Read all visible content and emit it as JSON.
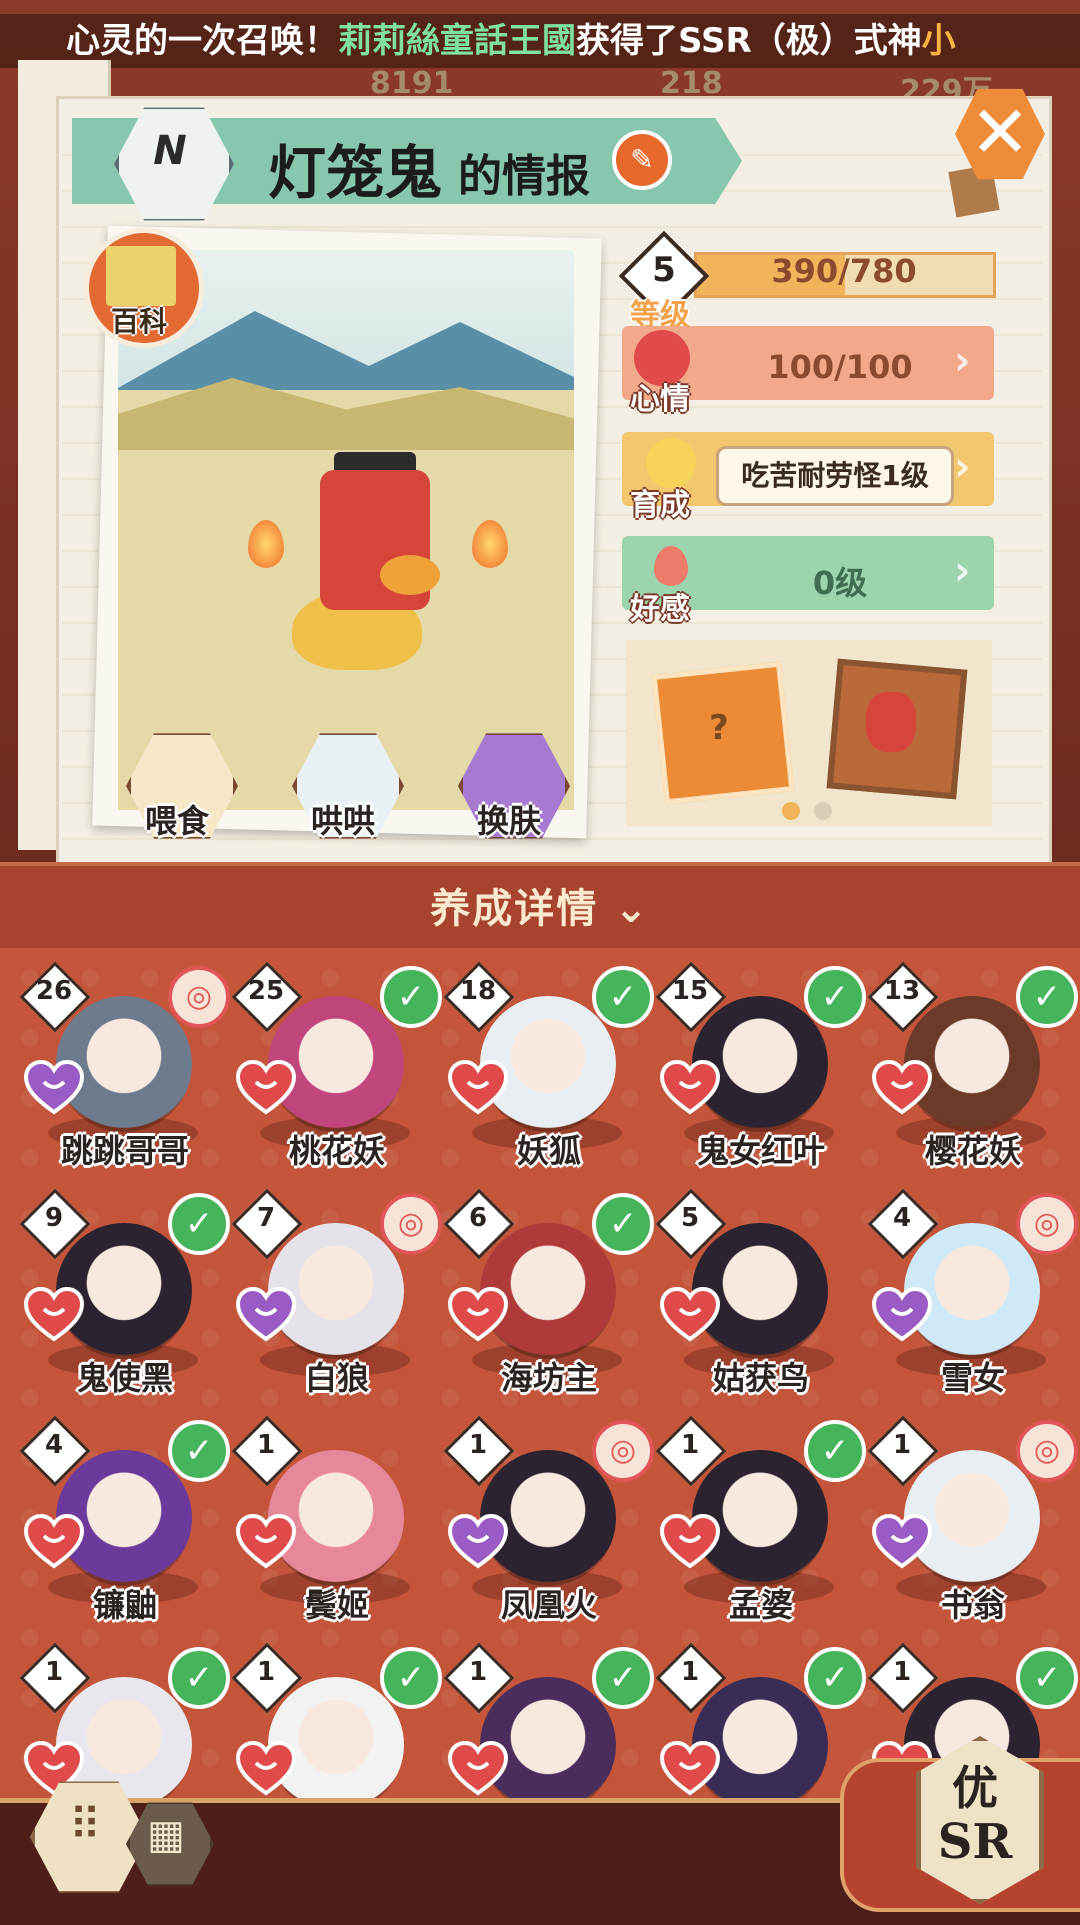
{
  "ticker": {
    "part1": "心灵的一次召唤！",
    "player": "莉莉絲童話王國",
    "part2": "获得了SSR（极）式神",
    "shikigami": "小"
  },
  "currencies": [
    "8191",
    "218",
    "229万"
  ],
  "header": {
    "rarity": "N",
    "name": "灯笼鬼",
    "suffix": "的情报"
  },
  "wiki": {
    "label": "百科"
  },
  "actions": [
    {
      "label": "喂食",
      "icon": "noodle-bowl-icon"
    },
    {
      "label": "哄哄",
      "icon": "milk-carton-icon"
    },
    {
      "label": "换肤",
      "icon": "skin-kimono-icon"
    }
  ],
  "stats": {
    "level": {
      "value": "5",
      "label": "等级",
      "xp": "390/780",
      "xp_fraction": 0.5
    },
    "mood": {
      "label": "心情",
      "value": "100/100"
    },
    "growth": {
      "label": "育成",
      "value": "吃苦耐劳怪1级"
    },
    "affinity": {
      "label": "好感",
      "value": "0级"
    }
  },
  "pictures": {
    "page_count": 2,
    "current_page": 1
  },
  "detail": {
    "label": "养成详情"
  },
  "shikigami_list": [
    {
      "level": "26",
      "name": "跳跳哥哥",
      "status": "ring",
      "heart": "purple",
      "hair": "#6d7b8c"
    },
    {
      "level": "25",
      "name": "桃花妖",
      "status": "check",
      "heart": "red",
      "hair": "#c0457a"
    },
    {
      "level": "18",
      "name": "妖狐",
      "status": "check",
      "heart": "red",
      "hair": "#e9eef2"
    },
    {
      "level": "15",
      "name": "鬼女红叶",
      "status": "check",
      "heart": "red",
      "hair": "#2b2430"
    },
    {
      "level": "13",
      "name": "樱花妖",
      "status": "check",
      "heart": "red",
      "hair": "#6b3a28"
    },
    {
      "level": "9",
      "name": "鬼使黑",
      "status": "check",
      "heart": "red",
      "hair": "#2b2430"
    },
    {
      "level": "7",
      "name": "白狼",
      "status": "ring",
      "heart": "purple",
      "hair": "#e6e2ea"
    },
    {
      "level": "6",
      "name": "海坊主",
      "status": "check",
      "heart": "red",
      "hair": "#b03a3a"
    },
    {
      "level": "5",
      "name": "姑获鸟",
      "status": "none",
      "heart": "red",
      "hair": "#2b2430"
    },
    {
      "level": "4",
      "name": "雪女",
      "status": "ring",
      "heart": "purple",
      "hair": "#cfe9f6"
    },
    {
      "level": "4",
      "name": "镰鼬",
      "status": "check",
      "heart": "red",
      "hair": "#6c3a9a"
    },
    {
      "level": "1",
      "name": "鬓姬",
      "status": "none",
      "heart": "red",
      "hair": "#e7879a"
    },
    {
      "level": "1",
      "name": "凤凰火",
      "status": "ring",
      "heart": "purple",
      "hair": "#2b2430"
    },
    {
      "level": "1",
      "name": "孟婆",
      "status": "check",
      "heart": "red",
      "hair": "#2b2430"
    },
    {
      "level": "1",
      "name": "书翁",
      "status": "ring",
      "heart": "purple",
      "hair": "#e9eef2"
    },
    {
      "level": "1",
      "name": "",
      "status": "check",
      "heart": "red",
      "hair": "#e9e6ee"
    },
    {
      "level": "1",
      "name": "",
      "status": "check",
      "heart": "red",
      "hair": "#f2f2f2"
    },
    {
      "level": "1",
      "name": "",
      "status": "check",
      "heart": "red",
      "hair": "#4a2d5a"
    },
    {
      "level": "1",
      "name": "",
      "status": "check",
      "heart": "red",
      "hair": "#3a2d55"
    },
    {
      "level": "1",
      "name": "",
      "status": "check",
      "heart": "red",
      "hair": "#2b2430"
    }
  ],
  "filter": {
    "top": "优",
    "bottom": "SR"
  },
  "view_toggle": {
    "grid_icon": "grid-view-icon",
    "list_icon": "list-view-icon"
  },
  "colors": {
    "mood": "#f2a98a",
    "growth": "#f3c76e",
    "affinity": "#9cd4ae",
    "check": "#46b45a",
    "accent": "#c4553a"
  }
}
